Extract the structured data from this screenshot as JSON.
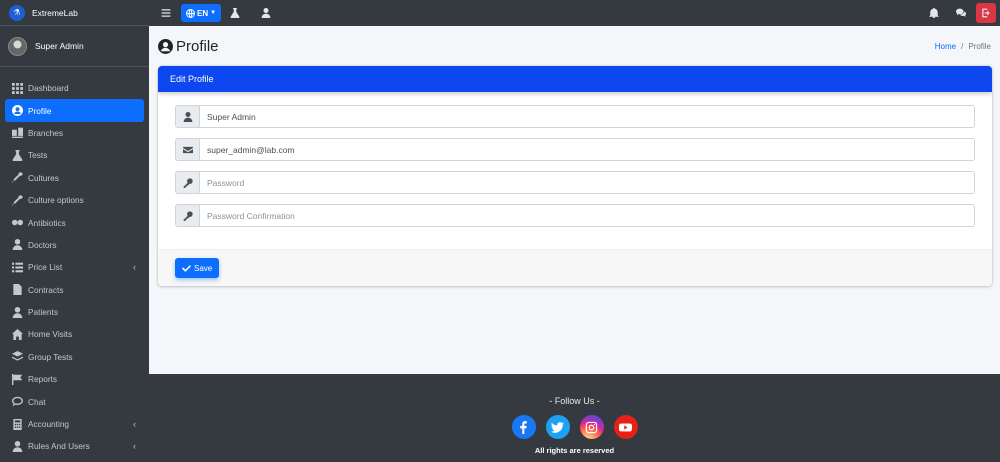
{
  "brand": {
    "name": "ExtremeLab"
  },
  "user": {
    "name": "Super Admin"
  },
  "sidebar": {
    "items": [
      {
        "label": "Dashboard",
        "icon": "dashboard-icon"
      },
      {
        "label": "Profile",
        "icon": "user-circle-icon",
        "active": true
      },
      {
        "label": "Branches",
        "icon": "branches-icon"
      },
      {
        "label": "Tests",
        "icon": "flask-icon"
      },
      {
        "label": "Cultures",
        "icon": "eyedropper-icon"
      },
      {
        "label": "Culture options",
        "icon": "eyedropper-icon"
      },
      {
        "label": "Antibiotics",
        "icon": "capsules-icon"
      },
      {
        "label": "Doctors",
        "icon": "doctor-icon"
      },
      {
        "label": "Price List",
        "icon": "list-icon",
        "expandable": true
      },
      {
        "label": "Contracts",
        "icon": "contract-icon"
      },
      {
        "label": "Patients",
        "icon": "patients-icon"
      },
      {
        "label": "Home Visits",
        "icon": "home-icon"
      },
      {
        "label": "Group Tests",
        "icon": "layers-icon"
      },
      {
        "label": "Reports",
        "icon": "flag-icon"
      },
      {
        "label": "Chat",
        "icon": "chat-icon"
      },
      {
        "label": "Accounting",
        "icon": "calculator-icon",
        "expandable": true
      },
      {
        "label": "Rules And Users",
        "icon": "users-icon",
        "expandable": true
      }
    ]
  },
  "topbar": {
    "lang_label": "EN"
  },
  "page": {
    "title": "Profile",
    "breadcrumb": {
      "home": "Home",
      "current": "Profile"
    }
  },
  "form": {
    "header": "Edit Profile",
    "name_value": "Super Admin",
    "email_value": "super_admin@lab.com",
    "password_placeholder": "Password",
    "password_confirm_placeholder": "Password Confirmation",
    "save_label": "Save"
  },
  "footer": {
    "follow_text": "- Follow Us -",
    "copyright": "All rights are reserved",
    "social": [
      {
        "name": "facebook-icon",
        "color": "#1877f2"
      },
      {
        "name": "twitter-icon",
        "color": "#1da1f2"
      },
      {
        "name": "instagram-icon",
        "color": "#c13584"
      },
      {
        "name": "youtube-icon",
        "color": "#e62117"
      }
    ]
  },
  "colors": {
    "primary": "#0d6efd",
    "card_header": "#0d47f0",
    "danger": "#dc3545",
    "sidebar": "#343a40"
  }
}
